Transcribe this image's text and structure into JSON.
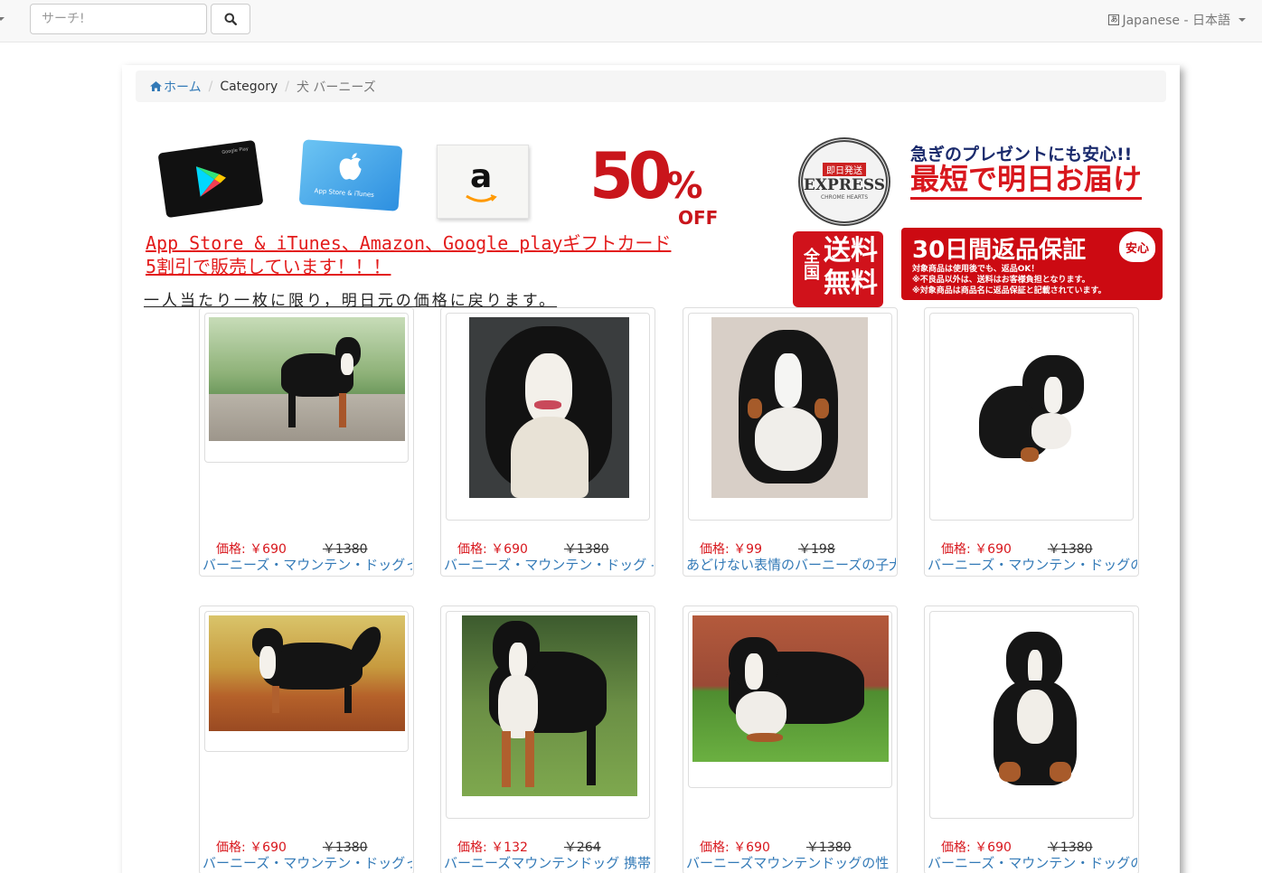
{
  "search": {
    "placeholder": "サーチ!"
  },
  "language": {
    "label": "Japanese - 日本語",
    "flag_glyph": "あ"
  },
  "breadcrumb": {
    "home": "ホーム",
    "category": "Category",
    "current": "犬 バーニーズ"
  },
  "banner": {
    "gplay_text": "Google Play",
    "apple_text": "App Store & iTunes",
    "amazon_logo": "a",
    "off_number": "50",
    "off_percent": "%",
    "off_word": "OFF",
    "promo_line1": "App Store & iTunes、Amazon、Google playギフトカード",
    "promo_line2": "5割引で販売しています！！！",
    "promo_line3": "一人当たり一枚に限り，明日元の価格に戻ります。",
    "seal_top": "即日発送",
    "seal_main": "EXPRESS",
    "seal_sub": "CHROME HEARTS",
    "right_line1": "急ぎのプレゼントにも安心!!",
    "right_line2": "最短で明日お届け",
    "ship_small": "全国",
    "ship_big": "送料無料",
    "return_main": "30日間返品保証",
    "return_badge": "安心",
    "return_note1": "対象商品は使用後でも、返品OK！",
    "return_note2": "※不良品以外は、送料はお客様負担となります。",
    "return_note3": "※対象商品は商品名に返品保証と記載されています。"
  },
  "price_label": "価格:",
  "products": [
    {
      "price": "￥690",
      "original": "￥1380",
      "title": "バーニーズ・マウンテン・ドッグっ"
    },
    {
      "price": "￥690",
      "original": "￥1380",
      "title": "バーニーズ・マウンテン・ドッグ -"
    },
    {
      "price": "￥99",
      "original": "￥198",
      "title": "あどけない表情のバーニーズの子犬"
    },
    {
      "price": "￥690",
      "original": "￥1380",
      "title": "バーニーズ・マウンテン・ドッグの"
    },
    {
      "price": "￥690",
      "original": "￥1380",
      "title": "バーニーズ・マウンテン・ドッグっ"
    },
    {
      "price": "￥132",
      "original": "￥264",
      "title": "バーニーズマウンテンドッグ 携帯"
    },
    {
      "price": "￥690",
      "original": "￥1380",
      "title": "バーニーズマウンテンドッグの性"
    },
    {
      "price": "￥690",
      "original": "￥1380",
      "title": "バーニーズ・マウンテン・ドッグの"
    }
  ]
}
